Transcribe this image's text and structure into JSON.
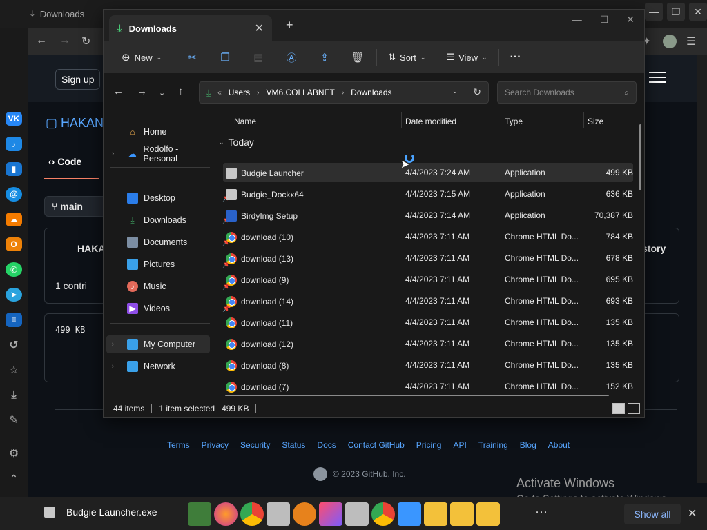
{
  "browser": {
    "tab_title": "Downloads",
    "sign_up": "Sign up",
    "repo_name": "HAKAN",
    "code_tab": "Code",
    "branch": "main",
    "owner": "HAKA",
    "contributors": "1 contri",
    "history": "story",
    "file_size": "499 KB",
    "footer_links": [
      "Terms",
      "Privacy",
      "Security",
      "Status",
      "Docs",
      "Contact GitHub",
      "Pricing",
      "API",
      "Training",
      "Blog",
      "About"
    ],
    "copyright": "© 2023 GitHub, Inc."
  },
  "activation": {
    "title": "Activate Windows",
    "subtitle": "Go to Settings to activate Windows."
  },
  "explorer": {
    "tab_title": "Downloads",
    "toolbar": {
      "new_label": "New",
      "sort_label": "Sort",
      "view_label": "View",
      "more_label": "···"
    },
    "address": [
      "Users",
      "VM6.COLLABNET",
      "Downloads"
    ],
    "search_placeholder": "Search Downloads",
    "nav": {
      "home": "Home",
      "onedrive": "Rodolfo - Personal",
      "desktop": "Desktop",
      "downloads": "Downloads",
      "documents": "Documents",
      "pictures": "Pictures",
      "music": "Music",
      "videos": "Videos",
      "my_computer": "My Computer",
      "network": "Network"
    },
    "columns": {
      "name": "Name",
      "date": "Date modified",
      "type": "Type",
      "size": "Size"
    },
    "group": "Today",
    "files": [
      {
        "name": "Budgie Launcher",
        "date": "4/4/2023 7:24 AM",
        "type": "Application",
        "size": "499 KB",
        "icon": "app-icon"
      },
      {
        "name": "Budgie_Dockx64",
        "date": "4/4/2023 7:15 AM",
        "type": "Application",
        "size": "636 KB",
        "icon": "app-icon"
      },
      {
        "name": "BirdyImg Setup",
        "date": "4/4/2023 7:14 AM",
        "type": "Application",
        "size": "70,387 KB",
        "icon": "setup-icon"
      },
      {
        "name": "download (10)",
        "date": "4/4/2023 7:11 AM",
        "type": "Chrome HTML Do...",
        "size": "784 KB",
        "icon": "chrome-icon"
      },
      {
        "name": "download (13)",
        "date": "4/4/2023 7:11 AM",
        "type": "Chrome HTML Do...",
        "size": "678 KB",
        "icon": "chrome-icon"
      },
      {
        "name": "download (9)",
        "date": "4/4/2023 7:11 AM",
        "type": "Chrome HTML Do...",
        "size": "695 KB",
        "icon": "chrome-icon"
      },
      {
        "name": "download (14)",
        "date": "4/4/2023 7:11 AM",
        "type": "Chrome HTML Do...",
        "size": "693 KB",
        "icon": "chrome-icon"
      },
      {
        "name": "download (11)",
        "date": "4/4/2023 7:11 AM",
        "type": "Chrome HTML Do...",
        "size": "135 KB",
        "icon": "chrome-icon"
      },
      {
        "name": "download (12)",
        "date": "4/4/2023 7:11 AM",
        "type": "Chrome HTML Do...",
        "size": "135 KB",
        "icon": "chrome-icon"
      },
      {
        "name": "download (8)",
        "date": "4/4/2023 7:11 AM",
        "type": "Chrome HTML Do...",
        "size": "135 KB",
        "icon": "chrome-icon"
      },
      {
        "name": "download (7)",
        "date": "4/4/2023 7:11 AM",
        "type": "Chrome HTML Do...",
        "size": "152 KB",
        "icon": "chrome-icon"
      }
    ],
    "status": {
      "items": "44 items",
      "selected": "1 item selected",
      "selected_size": "499 KB"
    }
  },
  "downloadbar": {
    "file": "Budgie Launcher.exe",
    "show_all": "Show all"
  },
  "colors": {
    "accent": "#4aa3ff",
    "github_link": "#58a6ff",
    "download_green": "#48c774"
  }
}
